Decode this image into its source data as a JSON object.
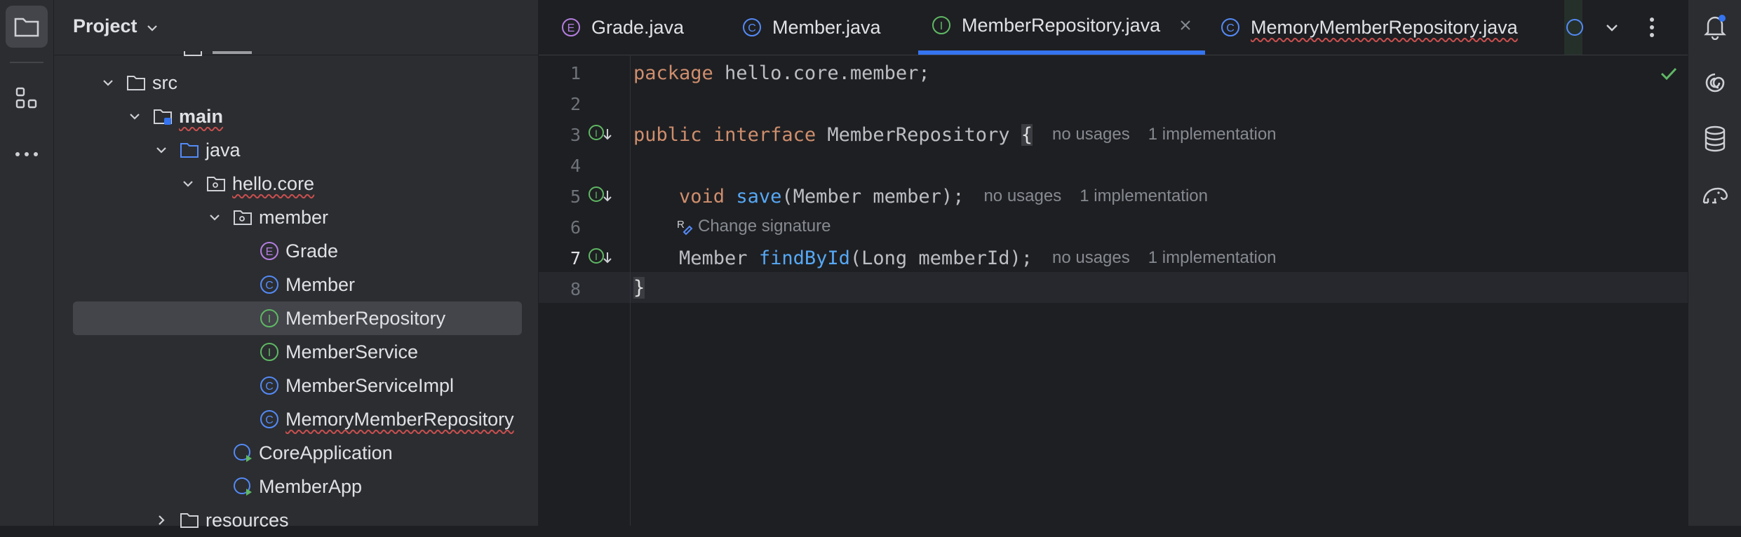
{
  "project_panel": {
    "title": "Project",
    "tree": [
      {
        "label": "src",
        "type": "folder",
        "indent": 1,
        "expanded": true,
        "typo": false
      },
      {
        "label": "main",
        "type": "source-folder",
        "indent": 2,
        "expanded": true,
        "typo": true,
        "bold": true
      },
      {
        "label": "java",
        "type": "java-folder",
        "indent": 3,
        "expanded": true,
        "typo": false
      },
      {
        "label": "hello.core",
        "type": "package",
        "indent": 4,
        "expanded": true,
        "typo": true
      },
      {
        "label": "member",
        "type": "package",
        "indent": 5,
        "expanded": true,
        "typo": false
      },
      {
        "label": "Grade",
        "type": "enum",
        "indent": 6,
        "typo": false
      },
      {
        "label": "Member",
        "type": "class",
        "indent": 6,
        "typo": false
      },
      {
        "label": "MemberRepository",
        "type": "interface",
        "indent": 6,
        "typo": false,
        "selected": true
      },
      {
        "label": "MemberService",
        "type": "interface",
        "indent": 6,
        "typo": false
      },
      {
        "label": "MemberServiceImpl",
        "type": "class",
        "indent": 6,
        "typo": false
      },
      {
        "label": "MemoryMemberRepository",
        "type": "class",
        "indent": 6,
        "typo": true
      },
      {
        "label": "CoreApplication",
        "type": "app",
        "indent": 5,
        "typo": false
      },
      {
        "label": "MemberApp",
        "type": "app",
        "indent": 5,
        "typo": false
      },
      {
        "label": "resources",
        "type": "folder",
        "indent": 3,
        "expanded": false,
        "typo": false
      }
    ]
  },
  "tabs": [
    {
      "label": "Grade.java",
      "type": "enum"
    },
    {
      "label": "Member.java",
      "type": "class"
    },
    {
      "label": "MemberRepository.java",
      "type": "interface",
      "active": true
    },
    {
      "label": "MemoryMemberRepository.java",
      "type": "class",
      "typo": true
    }
  ],
  "editor": {
    "line_numbers": [
      "1",
      "2",
      "3",
      "4",
      "5",
      "6",
      "7",
      "8"
    ],
    "current_line": "7",
    "line1": {
      "kw": "package",
      "rest": " hello.core.member;"
    },
    "line3": {
      "kw1": "public",
      "kw2": "interface",
      "name": " MemberRepository ",
      "brace": "{",
      "hint1": "no usages",
      "hint2": "1 implementation"
    },
    "line5": {
      "kw": "void",
      "fn": "save",
      "rest": "(Member member);",
      "hint1": "no usages",
      "hint2": "1 implementation"
    },
    "inlay": "Change signature",
    "line6": {
      "type": "Member",
      "fn": "findById",
      "rest": "(Long memberId);",
      "hint1": "no usages",
      "hint2": "1 implementation"
    },
    "line7": {
      "brace": "}"
    }
  },
  "colors": {
    "accent": "#3574f0",
    "keyword": "#cf8e6d",
    "function": "#56a8f5",
    "ok": "#5fb865"
  }
}
